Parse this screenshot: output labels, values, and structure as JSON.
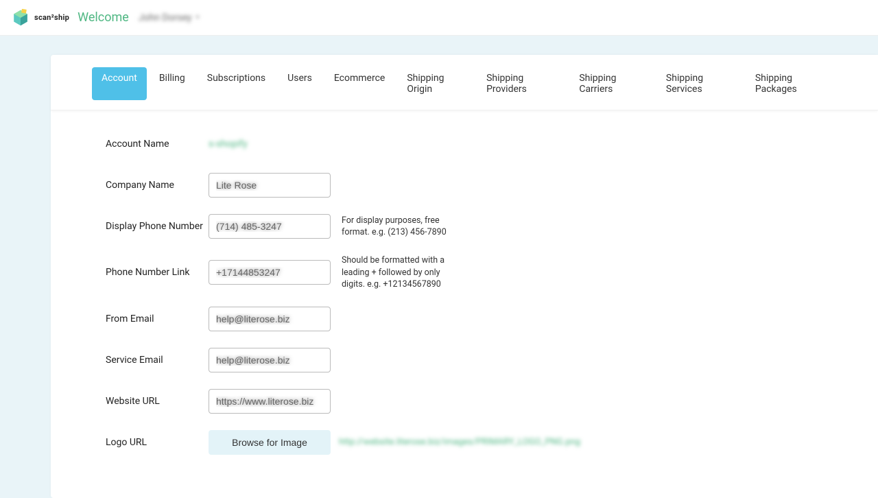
{
  "header": {
    "brand": "scan²ship",
    "welcome": "Welcome",
    "user_name": "John Dorsey"
  },
  "tabs": [
    "Account",
    "Billing",
    "Subscriptions",
    "Users",
    "Ecommerce",
    "Shipping Origin",
    "Shipping Providers",
    "Shipping Carriers",
    "Shipping Services",
    "Shipping Packages"
  ],
  "form": {
    "account_name": {
      "label": "Account Name",
      "value": "s-shopify"
    },
    "company_name": {
      "label": "Company Name",
      "value": "Lite Rose"
    },
    "display_phone": {
      "label": "Display Phone Number",
      "value": "(714) 485-3247",
      "helper": "For display purposes, free format. e.g. (213) 456-7890"
    },
    "phone_link": {
      "label": "Phone Number Link",
      "value": "+17144853247",
      "helper": "Should be formatted with a leading + followed by only digits. e.g. +12134567890"
    },
    "from_email": {
      "label": "From Email",
      "value": "help@literose.biz"
    },
    "service_email": {
      "label": "Service Email",
      "value": "help@literose.biz"
    },
    "website_url": {
      "label": "Website URL",
      "value": "https://www.literose.biz"
    },
    "logo_url": {
      "label": "Logo URL",
      "button": "Browse for Image",
      "link": "http://website.literose.biz/images/PRIMARY_LOGO_PNG.png"
    }
  }
}
